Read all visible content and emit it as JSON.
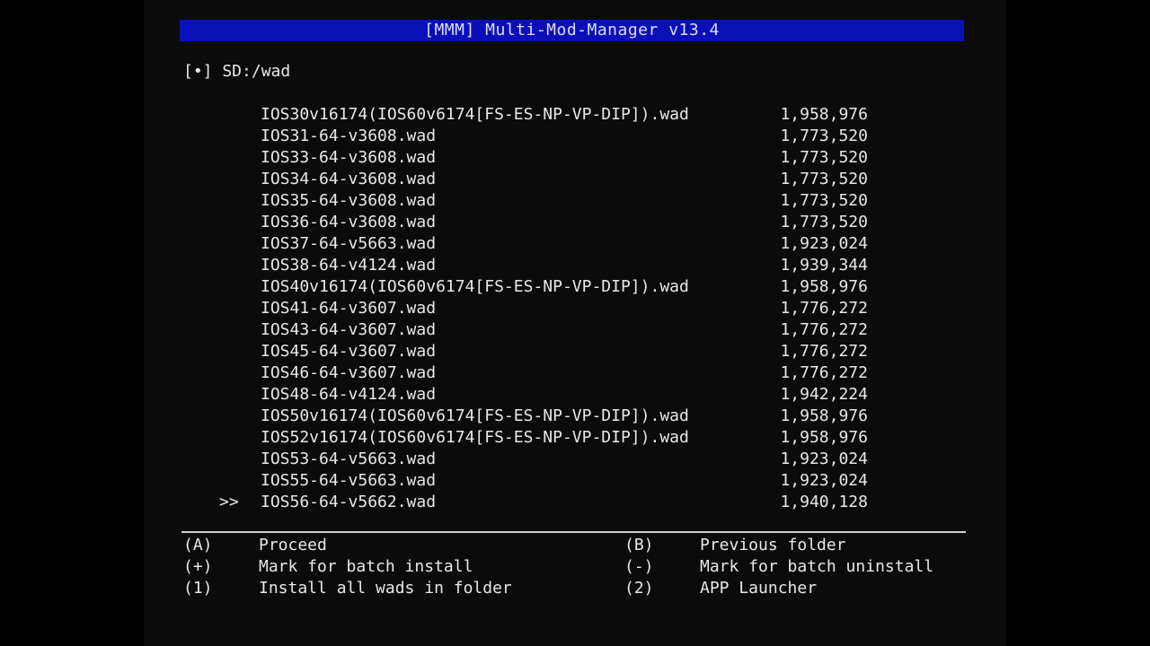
{
  "header": {
    "title": "[MMM] Multi-Mod-Manager v13.4"
  },
  "location": {
    "path": "[•] SD:/wad"
  },
  "cursor_glyph": ">>",
  "selected_index": 18,
  "files": [
    {
      "name": "IOS30v16174(IOS60v6174[FS-ES-NP-VP-DIP]).wad",
      "size": "1,958,976"
    },
    {
      "name": "IOS31-64-v3608.wad",
      "size": "1,773,520"
    },
    {
      "name": "IOS33-64-v3608.wad",
      "size": "1,773,520"
    },
    {
      "name": "IOS34-64-v3608.wad",
      "size": "1,773,520"
    },
    {
      "name": "IOS35-64-v3608.wad",
      "size": "1,773,520"
    },
    {
      "name": "IOS36-64-v3608.wad",
      "size": "1,773,520"
    },
    {
      "name": "IOS37-64-v5663.wad",
      "size": "1,923,024"
    },
    {
      "name": "IOS38-64-v4124.wad",
      "size": "1,939,344"
    },
    {
      "name": "IOS40v16174(IOS60v6174[FS-ES-NP-VP-DIP]).wad",
      "size": "1,958,976"
    },
    {
      "name": "IOS41-64-v3607.wad",
      "size": "1,776,272"
    },
    {
      "name": "IOS43-64-v3607.wad",
      "size": "1,776,272"
    },
    {
      "name": "IOS45-64-v3607.wad",
      "size": "1,776,272"
    },
    {
      "name": "IOS46-64-v3607.wad",
      "size": "1,776,272"
    },
    {
      "name": "IOS48-64-v4124.wad",
      "size": "1,942,224"
    },
    {
      "name": "IOS50v16174(IOS60v6174[FS-ES-NP-VP-DIP]).wad",
      "size": "1,958,976"
    },
    {
      "name": "IOS52v16174(IOS60v6174[FS-ES-NP-VP-DIP]).wad",
      "size": "1,958,976"
    },
    {
      "name": "IOS53-64-v5663.wad",
      "size": "1,923,024"
    },
    {
      "name": "IOS55-64-v5663.wad",
      "size": "1,923,024"
    },
    {
      "name": "IOS56-64-v5662.wad",
      "size": "1,940,128"
    }
  ],
  "help": [
    {
      "key_left": "(A)",
      "label_left": "Proceed",
      "key_right": "(B)",
      "label_right": "Previous folder"
    },
    {
      "key_left": "(+)",
      "label_left": "Mark for batch install",
      "key_right": "(-)",
      "label_right": "Mark for batch uninstall"
    },
    {
      "key_left": "(1)",
      "label_left": "Install all wads in folder",
      "key_right": "(2)",
      "label_right": "APP Launcher"
    }
  ],
  "colors": {
    "title_bar": "#0a10b8",
    "text": "#e8e8e8",
    "background": "#0b0b0b"
  }
}
